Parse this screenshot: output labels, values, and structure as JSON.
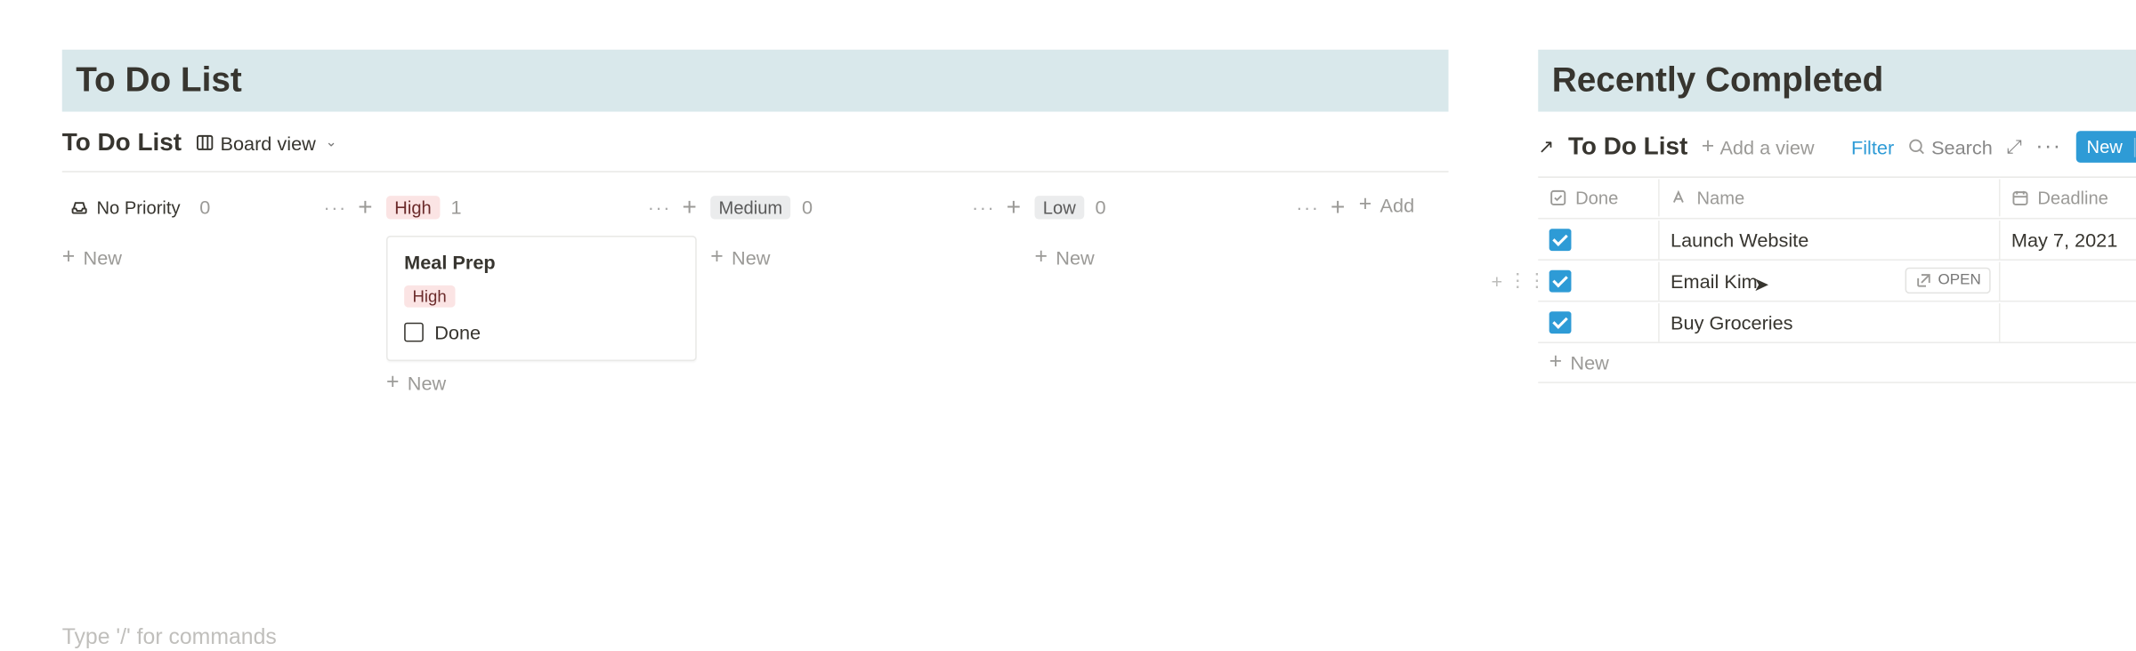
{
  "left": {
    "block_title": "To Do List",
    "db_title": "To Do List",
    "view_label": "Board view",
    "columns": [
      {
        "name": "No Priority",
        "tag_class": "nopri",
        "count": "0",
        "show_card": false
      },
      {
        "name": "High",
        "tag_class": "high",
        "count": "1",
        "show_card": true
      },
      {
        "name": "Medium",
        "tag_class": "med",
        "count": "0",
        "show_card": false
      },
      {
        "name": "Low",
        "tag_class": "low",
        "count": "0",
        "show_card": false
      }
    ],
    "card": {
      "title": "Meal Prep",
      "tag": "High",
      "done_label": "Done"
    },
    "new_label": "New",
    "add_label": "Add",
    "slash_hint": "Type '/' for commands"
  },
  "right": {
    "block_title": "Recently Completed",
    "link_title": "To Do List",
    "add_view": "Add a view",
    "filter": "Filter",
    "search": "Search",
    "new_btn": "New",
    "headers": {
      "done": "Done",
      "name": "Name",
      "deadline": "Deadline"
    },
    "rows": [
      {
        "name": "Launch Website",
        "deadline": "May 7, 2021",
        "hover": false
      },
      {
        "name": "Email Kim",
        "deadline": "",
        "hover": true
      },
      {
        "name": "Buy Groceries",
        "deadline": "",
        "hover": false
      }
    ],
    "open_label": "OPEN",
    "new_label": "New"
  }
}
